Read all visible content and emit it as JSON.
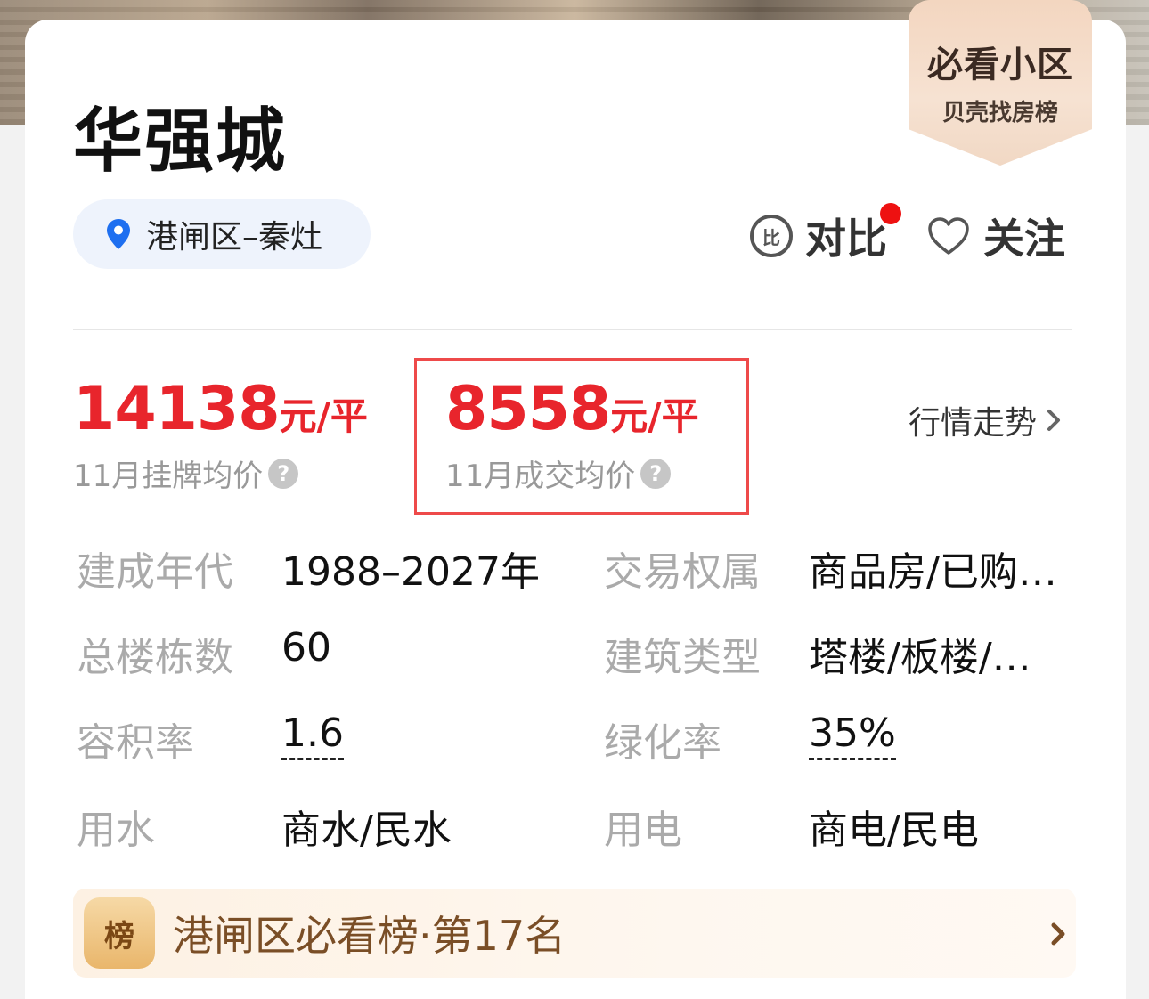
{
  "community": {
    "name": "华强城",
    "location": "港闸区–秦灶"
  },
  "badge": {
    "title": "必看小区",
    "subtitle": "贝壳找房榜"
  },
  "actions": {
    "compare_icon_text": "比",
    "compare_label": "对比",
    "follow_label": "关注"
  },
  "prices": {
    "listing": {
      "value": "14138",
      "unit": "元/平",
      "label": "11月挂牌均价"
    },
    "deal": {
      "value": "8558",
      "unit": "元/平",
      "label": "11月成交均价"
    },
    "help_icon_text": "?",
    "trend_link": "行情走势"
  },
  "info": {
    "build_era": {
      "key": "建成年代",
      "value": "1988–2027年"
    },
    "ownership": {
      "key": "交易权属",
      "value": "商品房/已购…"
    },
    "building_count": {
      "key": "总楼栋数",
      "value": "60"
    },
    "building_type": {
      "key": "建筑类型",
      "value": "塔楼/板楼/…"
    },
    "plot_ratio": {
      "key": "容积率",
      "value": "1.6"
    },
    "green_ratio": {
      "key": "绿化率",
      "value": "35%"
    },
    "water": {
      "key": "用水",
      "value": "商水/民水"
    },
    "electricity": {
      "key": "用电",
      "value": "商电/民电"
    }
  },
  "ranking": {
    "icon_text": "榜",
    "text": "港闸区必看榜·第17名"
  },
  "colors": {
    "price_red": "#e8252c",
    "accent_blue": "#1e6ff0",
    "highlight_border": "#ee4a4a"
  },
  "icons": [
    "location-pin-icon",
    "compare-icon",
    "heart-icon",
    "help-icon",
    "chevron-right-icon",
    "rank-icon"
  ]
}
